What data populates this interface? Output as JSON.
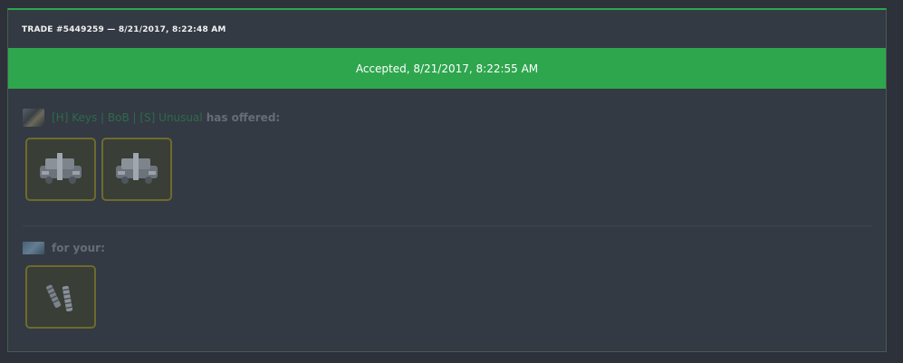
{
  "trade": {
    "header": "TRADE #5449259 — 8/21/2017, 8:22:48 AM",
    "status": "Accepted, 8/21/2017, 8:22:55 AM"
  },
  "offer": {
    "username": "[H] Keys | BoB | [S] Unusual",
    "suffix": "has offered:",
    "items": [
      {
        "icon": "robot-part-icon"
      },
      {
        "icon": "robot-part-icon"
      }
    ]
  },
  "receive": {
    "label": "for your:",
    "items": [
      {
        "icon": "metal-pieces-icon"
      }
    ]
  },
  "colors": {
    "accent": "#2ea64d",
    "background": "#333a44",
    "item_border": "#6e6a2e",
    "username": "#2f6a4a"
  }
}
